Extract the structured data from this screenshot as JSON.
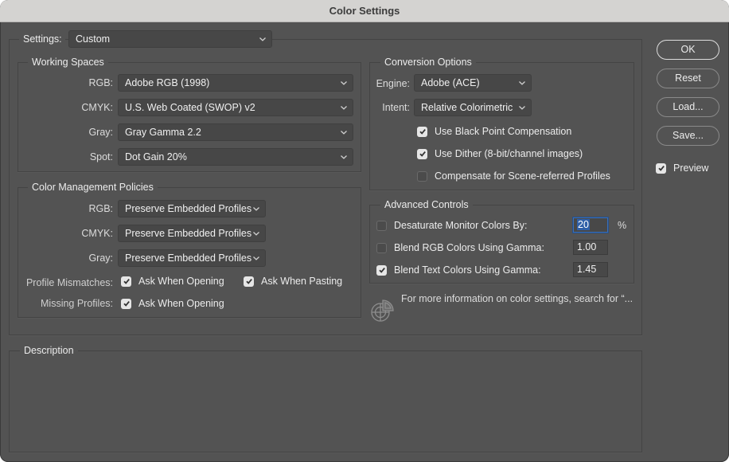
{
  "window": {
    "title": "Color Settings"
  },
  "settings": {
    "label": "Settings:",
    "value": "Custom"
  },
  "working_spaces": {
    "title": "Working Spaces",
    "rows": [
      {
        "label": "RGB:",
        "value": "Adobe RGB (1998)"
      },
      {
        "label": "CMYK:",
        "value": "U.S. Web Coated (SWOP) v2"
      },
      {
        "label": "Gray:",
        "value": "Gray Gamma 2.2"
      },
      {
        "label": "Spot:",
        "value": "Dot Gain 20%"
      }
    ]
  },
  "policies": {
    "title": "Color Management Policies",
    "rows": [
      {
        "label": "RGB:",
        "value": "Preserve Embedded Profiles"
      },
      {
        "label": "CMYK:",
        "value": "Preserve Embedded Profiles"
      },
      {
        "label": "Gray:",
        "value": "Preserve Embedded Profiles"
      }
    ],
    "profile_mismatches": {
      "label": "Profile Mismatches:",
      "ask_opening": {
        "label": "Ask When Opening",
        "checked": true
      },
      "ask_pasting": {
        "label": "Ask When Pasting",
        "checked": true
      }
    },
    "missing_profiles": {
      "label": "Missing Profiles:",
      "ask_opening": {
        "label": "Ask When Opening",
        "checked": true
      }
    }
  },
  "conversion": {
    "title": "Conversion Options",
    "engine": {
      "label": "Engine:",
      "value": "Adobe (ACE)"
    },
    "intent": {
      "label": "Intent:",
      "value": "Relative Colorimetric"
    },
    "options": [
      {
        "label": "Use Black Point Compensation",
        "checked": true
      },
      {
        "label": "Use Dither (8-bit/channel images)",
        "checked": true
      },
      {
        "label": "Compensate for Scene-referred Profiles",
        "checked": false
      }
    ]
  },
  "advanced": {
    "title": "Advanced Controls",
    "desaturate": {
      "label": "Desaturate Monitor Colors By:",
      "checked": false,
      "value": "20",
      "unit": "%"
    },
    "blend_rgb": {
      "label": "Blend RGB Colors Using Gamma:",
      "checked": false,
      "value": "1.00"
    },
    "blend_text": {
      "label": "Blend Text Colors Using Gamma:",
      "checked": true,
      "value": "1.45"
    }
  },
  "info": {
    "text": "For more information on color settings, search for “...",
    "icon": "color-settings-icon"
  },
  "description": {
    "title": "Description",
    "text": ""
  },
  "buttons": {
    "ok": "OK",
    "reset": "Reset",
    "load": "Load...",
    "save": "Save..."
  },
  "preview": {
    "label": "Preview",
    "checked": true
  },
  "colors": {
    "dialog_bg": "#535353",
    "titlebar_bg": "#d4d3d1",
    "focus_blue": "#3a6fb8"
  }
}
